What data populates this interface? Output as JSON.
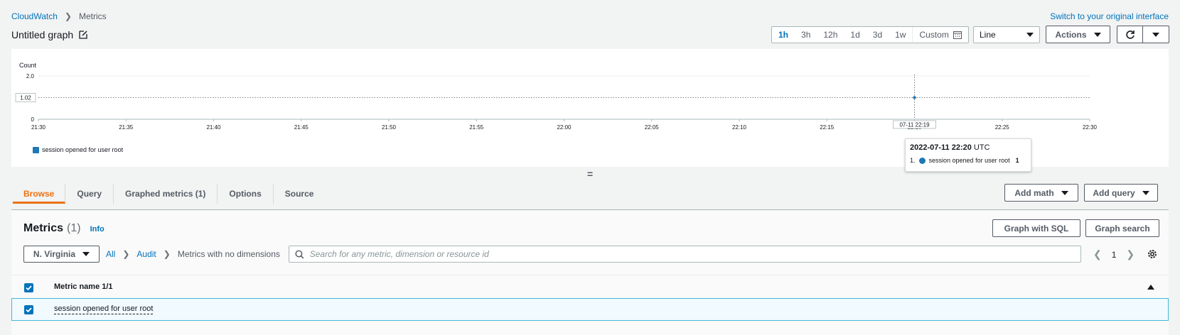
{
  "breadcrumb": {
    "root": "CloudWatch",
    "current": "Metrics"
  },
  "switch_link": "Switch to your original interface",
  "graph_title": "Untitled graph",
  "time_range": {
    "options": [
      "1h",
      "3h",
      "12h",
      "1d",
      "3d",
      "1w"
    ],
    "active": "1h",
    "custom_label": "Custom"
  },
  "graph_type": "Line",
  "toolbar": {
    "actions_label": "Actions"
  },
  "chart_data": {
    "type": "line",
    "ylabel": "Count",
    "yticks": [
      "2.0",
      "0"
    ],
    "ylim": [
      0,
      2
    ],
    "xticks": [
      "21:30",
      "21:35",
      "21:40",
      "21:45",
      "21:50",
      "21:55",
      "22:00",
      "22:05",
      "22:10",
      "22:15",
      "22:20",
      "22:25",
      "22:30"
    ],
    "series": [
      {
        "name": "session opened for user root",
        "color": "#1f77b4",
        "points": [
          {
            "x": "22:20",
            "y": 1
          }
        ]
      }
    ],
    "hover_y_label": "1.02",
    "hover_x_label": "07-11 22:19",
    "legend_position": "bottom-left"
  },
  "tooltip": {
    "date": "2022-07-11 22:20",
    "tz": "UTC",
    "index": "1.",
    "series": "session opened for user root",
    "value": "1"
  },
  "divider_glyph": "=",
  "tabs": [
    "Browse",
    "Query",
    "Graphed metrics (1)",
    "Options",
    "Source"
  ],
  "active_tab": "Browse",
  "buttons": {
    "add_math": "Add math",
    "add_query": "Add query",
    "graph_sql": "Graph with SQL",
    "graph_search": "Graph search"
  },
  "metrics": {
    "title": "Metrics",
    "count": "(1)",
    "info": "Info",
    "region": "N. Virginia",
    "crumbs": [
      "All",
      "Audit"
    ],
    "crumb_current": "Metrics with no dimensions",
    "search_placeholder": "Search for any metric, dimension or resource id",
    "page": "1",
    "column_header": "Metric name 1/1",
    "rows": [
      "session opened for user root"
    ]
  },
  "colors": {
    "accent": "#0073bb",
    "active_tab": "#ec7211",
    "series": "#1f77b4"
  }
}
